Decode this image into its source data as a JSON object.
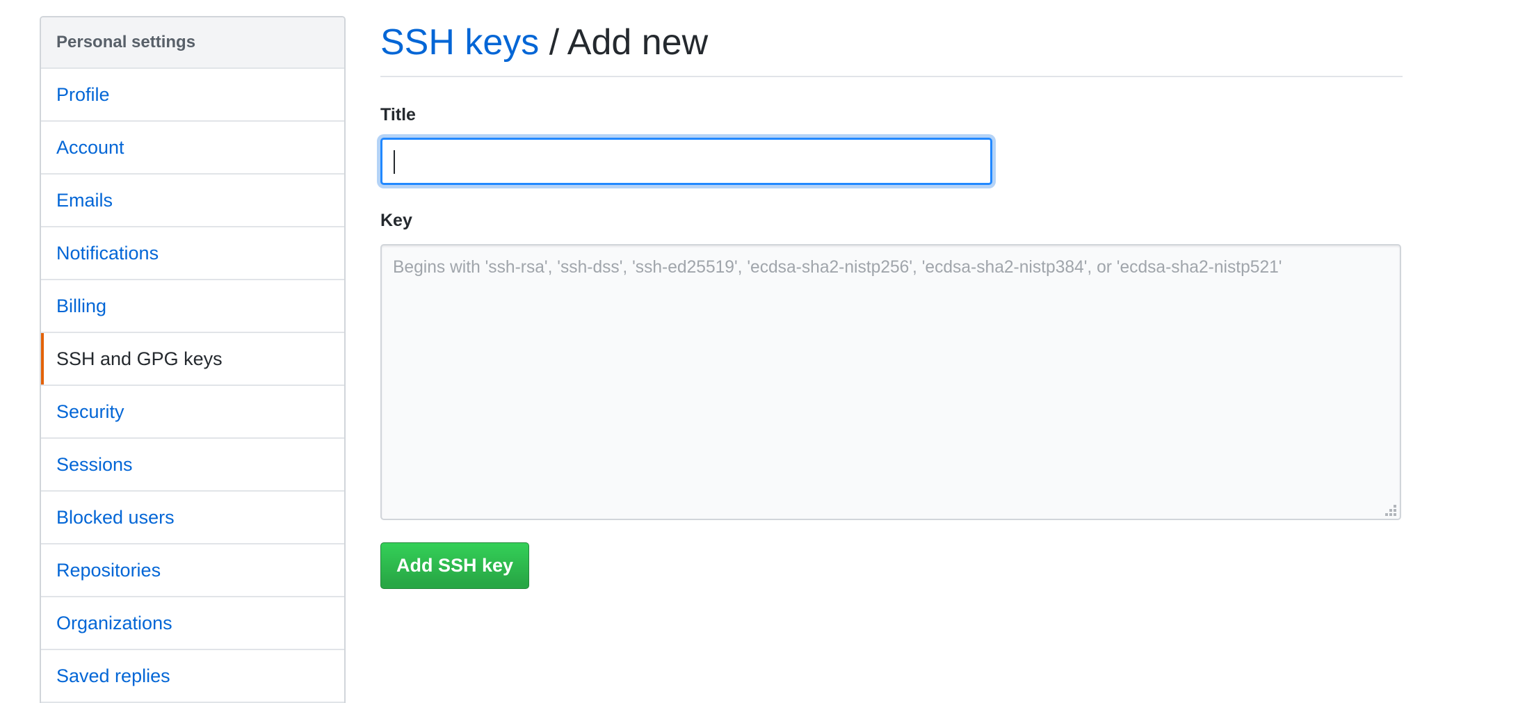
{
  "sidebar": {
    "header": "Personal settings",
    "items": [
      {
        "label": "Profile",
        "active": false
      },
      {
        "label": "Account",
        "active": false
      },
      {
        "label": "Emails",
        "active": false
      },
      {
        "label": "Notifications",
        "active": false
      },
      {
        "label": "Billing",
        "active": false
      },
      {
        "label": "SSH and GPG keys",
        "active": true
      },
      {
        "label": "Security",
        "active": false
      },
      {
        "label": "Sessions",
        "active": false
      },
      {
        "label": "Blocked users",
        "active": false
      },
      {
        "label": "Repositories",
        "active": false
      },
      {
        "label": "Organizations",
        "active": false
      },
      {
        "label": "Saved replies",
        "active": false
      }
    ]
  },
  "header": {
    "breadcrumb_link": "SSH keys",
    "separator": "/",
    "current": "Add new"
  },
  "form": {
    "title_label": "Title",
    "title_value": "",
    "key_label": "Key",
    "key_value": "",
    "key_placeholder": "Begins with 'ssh-rsa', 'ssh-dss', 'ssh-ed25519', 'ecdsa-sha2-nistp256', 'ecdsa-sha2-nistp384', or 'ecdsa-sha2-nistp521'",
    "submit_label": "Add SSH key"
  },
  "colors": {
    "link": "#0366d6",
    "active_indicator": "#e36209",
    "primary_button": "#28a745",
    "focus_border": "#2188ff"
  }
}
